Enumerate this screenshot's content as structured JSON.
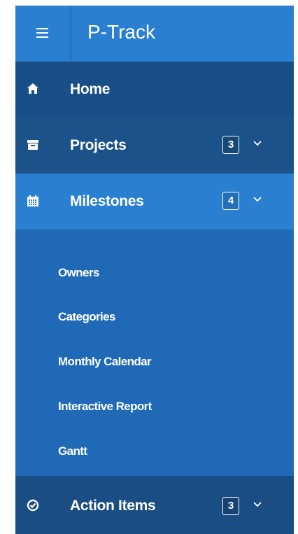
{
  "app": {
    "title": "P-Track"
  },
  "nav": {
    "items": [
      {
        "label": "Home",
        "icon": "home-icon"
      },
      {
        "label": "Projects",
        "icon": "archive-box-icon",
        "badge": "3"
      },
      {
        "label": "Milestones",
        "icon": "calendar-icon",
        "badge": "4",
        "expanded": true
      },
      {
        "label": "Action Items",
        "icon": "check-circle-icon",
        "badge": "3"
      }
    ],
    "milestones_submenu": [
      "Owners",
      "Categories",
      "Monthly Calendar",
      "Interactive Report",
      "Gantt"
    ]
  },
  "colors": {
    "header": "#2a7fd0",
    "nav_dark": "#194f88",
    "nav_active": "#2a7fd0",
    "submenu_bg": "#1f69b6",
    "text": "#ffffff"
  }
}
